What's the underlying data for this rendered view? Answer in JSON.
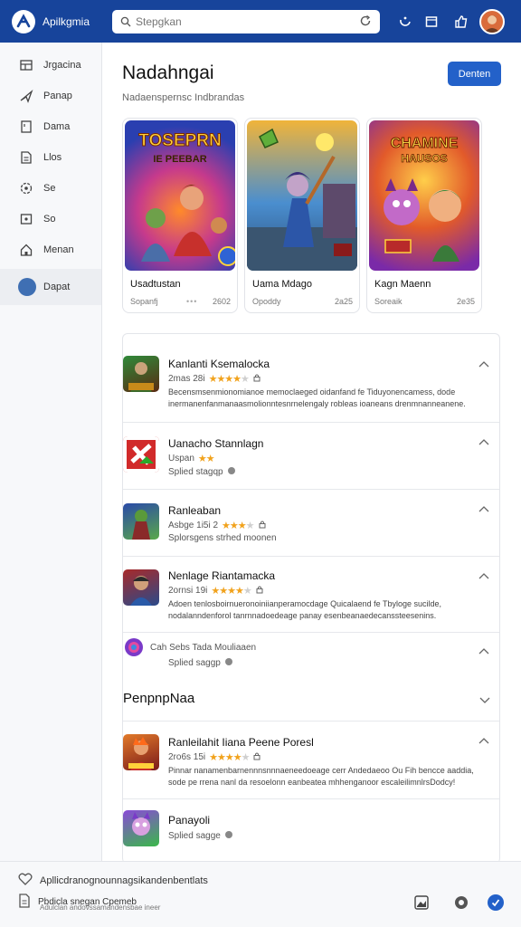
{
  "app": {
    "title": "Apilkgmia"
  },
  "search": {
    "placeholder": "Stepgkan"
  },
  "sidebar": {
    "items": [
      {
        "label": "Jrgacina",
        "icon": "grid-icon"
      },
      {
        "label": "Panap",
        "icon": "send-icon"
      },
      {
        "label": "Dama",
        "icon": "book-icon"
      },
      {
        "label": "Llos",
        "icon": "document-icon"
      },
      {
        "label": "Se",
        "icon": "settings-icon"
      },
      {
        "label": "So",
        "icon": "image-icon"
      },
      {
        "label": "Menan",
        "icon": "home-icon"
      },
      {
        "label": "Dapat",
        "icon": "avatar"
      }
    ]
  },
  "main": {
    "title": "Nadahngai",
    "subtitle": "Nadaenspernsc  Indbrandas",
    "primary_button": "Denten"
  },
  "cards": [
    {
      "art_title": "TOSEPRN",
      "art_sub": "IE PEEBAR",
      "name": "Usadtustan",
      "meta": "Sopanfj",
      "dots": "•••",
      "num": "2602"
    },
    {
      "art_title": "",
      "art_sub": "",
      "name": "Uama Mdago",
      "meta": "Opoddy",
      "dots": "",
      "num": "2a25"
    },
    {
      "art_title": "CHAMINE",
      "art_sub": "HAUSOS",
      "name": "Kagn Maenn",
      "meta": "Soreaik",
      "dots": "",
      "num": "2e35"
    }
  ],
  "list": {
    "rows": [
      {
        "title": "Kanlanti Ksemalocka",
        "meta": "2mas 28i",
        "stars": 4,
        "desc": "Becensmsenmionomianoe memoclaeged oidanfand fe Tiduyonencamess, dode inermanenfanmanaasmolionntesnrnelengaly robleas ioaneans drenmnanneanene."
      },
      {
        "title": "Uanacho Stannlagn",
        "meta": "Uspan",
        "stars": 2,
        "sub": "Splied stagqp"
      },
      {
        "title": "Ranleaban",
        "meta": "Asbge 1i5i 2",
        "stars": 3,
        "sub": "Splorsgens strhed moonen"
      },
      {
        "title": "Nenlage Riantamacka",
        "meta": "2ornsi 19i",
        "stars": 4,
        "desc": "Adoen tenlosboirnueronoiniianperamocdage Quicalaend fe Tbyloge sucilde, nodalanndenforol tanrnnadoedeage panay esenbeanaedecanssteesenins."
      },
      {
        "title": "Cah Sebs Tada Mouliaaen",
        "sub": "Splied saggp"
      }
    ],
    "section_title": "PenpnpNaa",
    "rows2": [
      {
        "title": "Ranleilahit Iiana Peene Poresl",
        "meta": "2ro6s 15i",
        "stars": 4,
        "desc": "Pinnar nanamenbarnennnsnnnaeneedoeage cerr Andedaeoo Ou Fih bencce aaddia, sode pe rrena nanl da resoelonn eanbeatea mhhenganoor escaleilimnlrsDodcy!"
      },
      {
        "title": "Panayoli",
        "sub": "Splied sagge"
      }
    ]
  },
  "footer": {
    "line1": "Apllicdranognounnagsikandenbentlats",
    "line2": "Pbdicla snegan Cpemeb",
    "line3": "Adulclan andovssamandensbae ineer"
  },
  "colors": {
    "topbar": "#17449b",
    "accent": "#2361c9",
    "star": "#f1a21c"
  }
}
